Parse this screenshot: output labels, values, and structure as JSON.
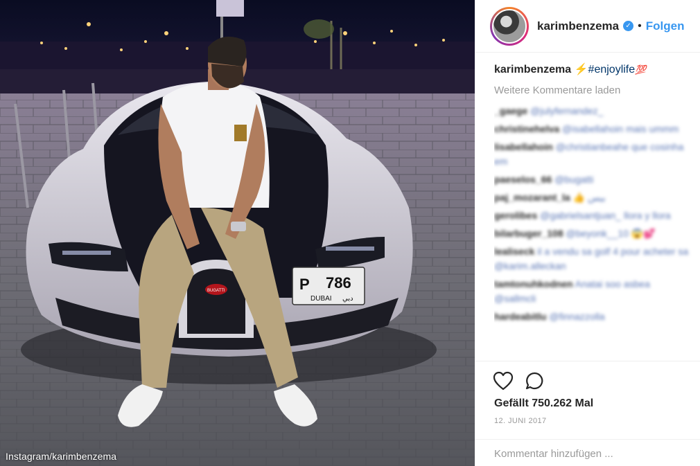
{
  "photo": {
    "credit": "Instagram/karimbenzema",
    "plate_letter": "P",
    "plate_number": "786",
    "plate_city": "DUBAI",
    "plate_arabic": "دبي",
    "grille_badge": "BUGATTI"
  },
  "header": {
    "username": "karimbenzema",
    "verified_icon": "verified-check-icon",
    "separator": "•",
    "follow_label": "Folgen"
  },
  "caption": {
    "username": "karimbenzema",
    "emoji_bolt": "⚡",
    "hashtag": "#enjoylife",
    "emoji_hundred": "💯"
  },
  "load_more": "Weitere Kommentare laden",
  "comments": [
    {
      "user": "_gaege",
      "text": "@julyfernandez_"
    },
    {
      "user": "christinehelva",
      "text": "@isabellahoin mais ummm"
    },
    {
      "user": "lisabellahoin",
      "text": "@christianbeahe que cosinha em"
    },
    {
      "user": "paeselos_66",
      "text": "@bugatti"
    },
    {
      "user": "paj_mozarant_la",
      "text": "👍 بيس"
    },
    {
      "user": "gerolibes",
      "text": "@gabrielsantjuan_ llora y llora"
    },
    {
      "user": "bilarbuger_108",
      "text": "@beyonk__10 😱💕"
    },
    {
      "user": "lealiseck",
      "text": "il a vendu sa golf 4 pour acheter sa @karim.alleckan"
    },
    {
      "user": "tamtonuhkodnen",
      "text": "Anatai soo asbea @sallmcli"
    },
    {
      "user": "hardeabitlu",
      "text": "@finnazzolla"
    }
  ],
  "actions": {
    "like_icon": "heart-icon",
    "comment_icon": "comment-bubble-icon",
    "likes_text": "Gefällt 750.262 Mal",
    "date": "12. JUNI 2017",
    "comment_placeholder": "Kommentar hinzufügen ..."
  },
  "colors": {
    "link_blue": "#3897f0",
    "hashtag_blue": "#003569",
    "muted_gray": "#999999",
    "text_dark": "#262626",
    "divider": "#efefef"
  }
}
